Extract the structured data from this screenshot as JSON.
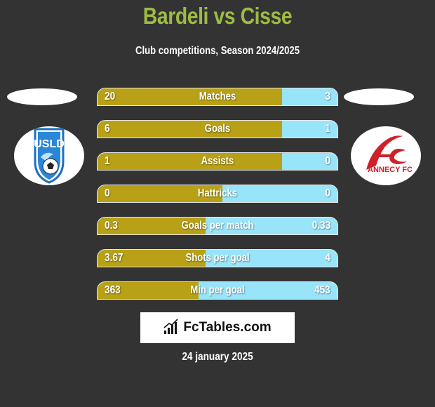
{
  "header": {
    "title": "Bardeli vs Cisse",
    "subtitle": "Club competitions, Season 2024/2025"
  },
  "teams": {
    "left": {
      "player": "Bardeli",
      "club_logo": "USLD",
      "logo_icon": "usld-crest-icon"
    },
    "right": {
      "player": "Cisse",
      "club_logo": "ANNECY FC",
      "logo_icon": "annecy-fc-crest-icon"
    }
  },
  "colors": {
    "title": "#9dbb45",
    "left_bar": "#b8a116",
    "right_bar": "#98e4f8",
    "background": "#333333"
  },
  "chart_data": {
    "type": "bar",
    "title": "Bardeli vs Cisse",
    "subtitle": "Club competitions, Season 2024/2025",
    "categories": [
      "Matches",
      "Goals",
      "Assists",
      "Hattricks",
      "Goals per match",
      "Shots per goal",
      "Min per goal"
    ],
    "series": [
      {
        "name": "Bardeli",
        "values": [
          "20",
          "6",
          "1",
          "0",
          "0.3",
          "3.67",
          "363"
        ]
      },
      {
        "name": "Cisse",
        "values": [
          "3",
          "1",
          "0",
          "0",
          "0.33",
          "4",
          "453"
        ]
      }
    ],
    "left_share": [
      0.77,
      0.77,
      0.77,
      0.52,
      0.45,
      0.45,
      0.42
    ]
  },
  "footer": {
    "brand": "FcTables.com",
    "date": "24 january 2025"
  }
}
